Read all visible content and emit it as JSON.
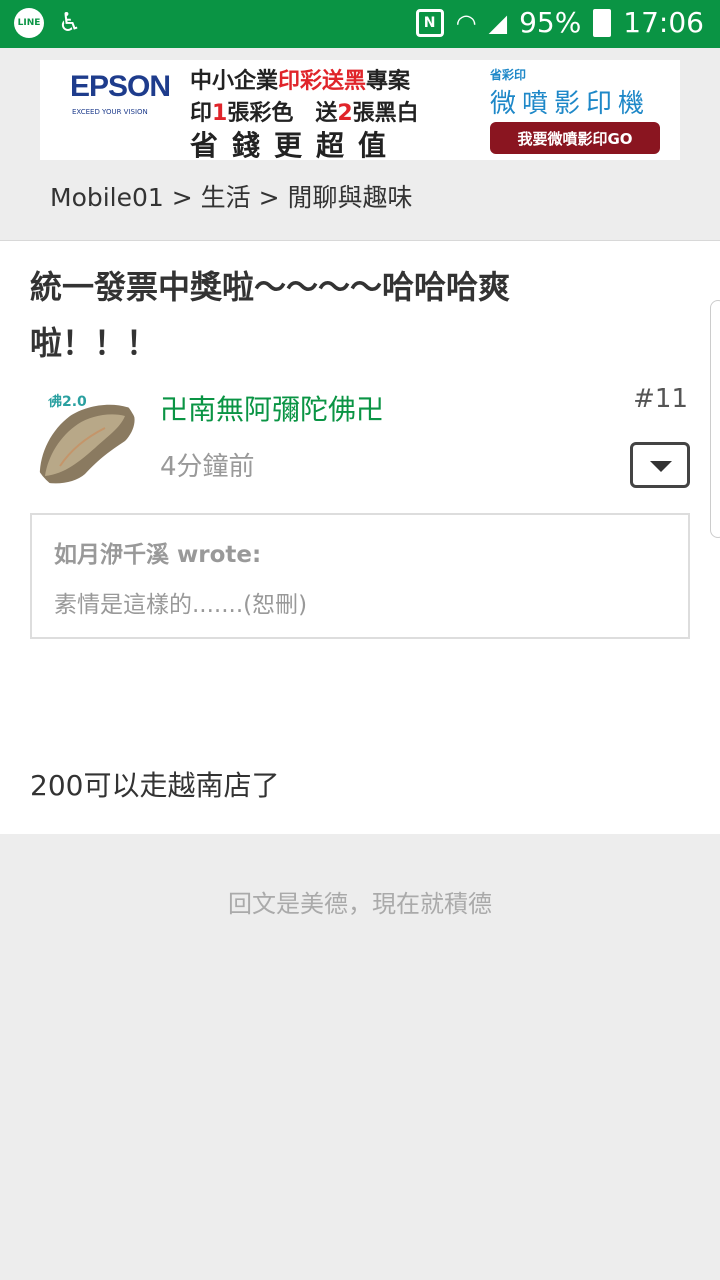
{
  "status_bar": {
    "line_label": "LINE",
    "battery": "95%",
    "time": "17:06",
    "nfc_label": "N"
  },
  "ad": {
    "brand": "EPSON",
    "brand_sub": "EXCEED YOUR VISION",
    "line1_a": "中小企業",
    "line1_b": "印彩送黑",
    "line1_c": "專案",
    "line2_a": "印",
    "line2_b": "1",
    "line2_c": "張彩色　送",
    "line2_d": "2",
    "line2_e": "張黑白",
    "line3": "省錢更超值",
    "right_logo": "省彩印",
    "right_machine": "微噴影印機",
    "go_button": "我要微噴影印GO"
  },
  "breadcrumb": "Mobile01 > 生活 > 閒聊與趣味",
  "post": {
    "title": "統一發票中獎啦～～～～哈哈哈爽啦！！！",
    "avatar_label": "佛2.0",
    "username": "卍南無阿彌陀佛卍",
    "time": "4分鐘前",
    "number": "#11",
    "quote": {
      "author": "如月洢千溪 wrote:",
      "text": "素情是這樣的.......(恕刪)"
    },
    "body": "200可以走越南店了"
  },
  "reply_prompt": "回文是美德，現在就積德",
  "colors": {
    "brand_green": "#0a9444",
    "background": "#ededed"
  }
}
